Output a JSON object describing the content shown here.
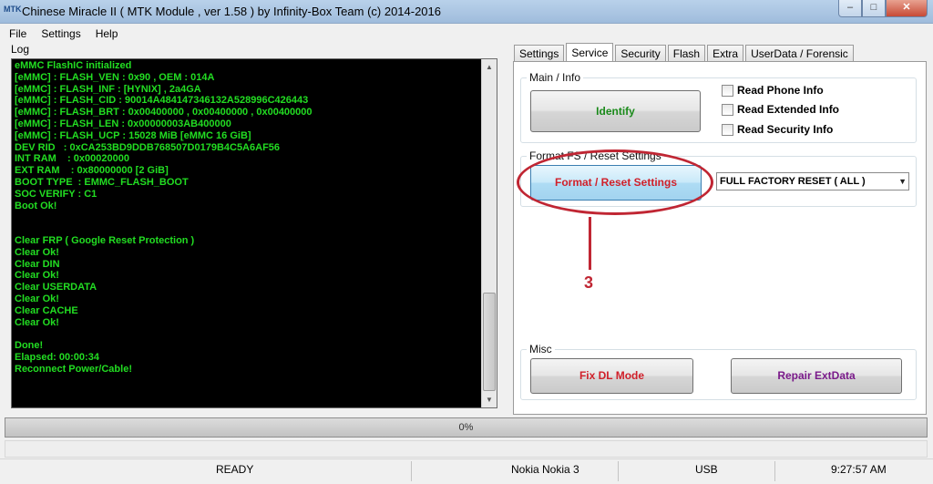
{
  "window": {
    "title": "Chinese Miracle II ( MTK Module , ver 1.58 ) by Infinity-Box Team (c) 2014-2016",
    "icon_text": "MTK",
    "controls": {
      "minimize": "–",
      "maximize": "□",
      "close": "✕"
    }
  },
  "menu": {
    "items": [
      "File",
      "Settings",
      "Help"
    ]
  },
  "log": {
    "label": "Log",
    "lines": [
      "eMMC FlashIC initialized",
      "[eMMC] : FLASH_VEN : 0x90 , OEM : 014A",
      "[eMMC] : FLASH_INF : [HYNIX] , 2a4GA",
      "[eMMC] : FLASH_CID : 90014A484147346132A528996C426443",
      "[eMMC] : FLASH_BRT : 0x00400000 , 0x00400000 , 0x00400000",
      "[eMMC] : FLASH_LEN : 0x00000003AB400000",
      "[eMMC] : FLASH_UCP : 15028 MiB [eMMC 16 GiB]",
      "DEV RID   : 0xCA253BD9DDB768507D0179B4C5A6AF56",
      "INT RAM    : 0x00020000",
      "EXT RAM    : 0x80000000 [2 GiB]",
      "BOOT TYPE  : EMMC_FLASH_BOOT",
      "SOC VERIFY : C1",
      "Boot Ok!",
      "",
      "",
      "Clear FRP ( Google Reset Protection )",
      "Clear Ok!",
      "Clear DIN",
      "Clear Ok!",
      "Clear USERDATA",
      "Clear Ok!",
      "Clear CACHE",
      "Clear Ok!",
      "",
      "Done!",
      "Elapsed: 00:00:34",
      "Reconnect Power/Cable!"
    ],
    "colors": {
      "background": "#000000",
      "text": "#22dd22"
    }
  },
  "tabs": [
    {
      "label": "Settings",
      "active": false
    },
    {
      "label": "Service",
      "active": true
    },
    {
      "label": "Security",
      "active": false
    },
    {
      "label": "Flash",
      "active": false
    },
    {
      "label": "Extra",
      "active": false
    },
    {
      "label": "UserData / Forensic",
      "active": false
    }
  ],
  "main_info": {
    "title": "Main / Info",
    "identify_label": "Identify",
    "checks": [
      "Read Phone Info",
      "Read Extended Info",
      "Read Security Info"
    ]
  },
  "format": {
    "title": "Format FS / Reset Settings",
    "button_label": "Format / Reset Settings",
    "selected_option": "FULL FACTORY RESET ( ALL )"
  },
  "annotation": {
    "number": "3",
    "color": "#c02633"
  },
  "misc": {
    "title": "Misc",
    "fix_dl_label": "Fix DL Mode",
    "repair_label": "Repair ExtData"
  },
  "progress": {
    "text": "0%",
    "value": 0
  },
  "status": {
    "state": "READY",
    "device": "Nokia Nokia 3",
    "port": "USB",
    "time": "9:27:57 AM"
  },
  "colors": {
    "identify_text": "#1a8a1a",
    "format_text": "#d0202a",
    "fix_dl_text": "#d0202a",
    "repair_text": "#7a1a8a"
  }
}
